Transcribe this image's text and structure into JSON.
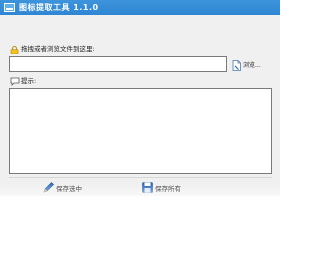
{
  "window": {
    "title": "图标提取工具 1.1.0",
    "icon": "app-window-icon"
  },
  "drop": {
    "icon": "lock-icon",
    "label": "拖拽或者浏览文件到这里:"
  },
  "path_input": {
    "value": "",
    "placeholder": ""
  },
  "browse": {
    "icon": "file-browse-icon",
    "label": "浏览..."
  },
  "hint": {
    "icon": "speech-bubble-icon",
    "label": "提示:",
    "value": ""
  },
  "actions": {
    "left": {
      "icon": "pencil-icon",
      "label": "保存选中"
    },
    "right": {
      "icon": "save-icon",
      "label": "保存所有"
    }
  },
  "colors": {
    "titlebar": "#3d95dc",
    "window_bg": "#f0f0f0",
    "border": "#7a7a7a"
  }
}
